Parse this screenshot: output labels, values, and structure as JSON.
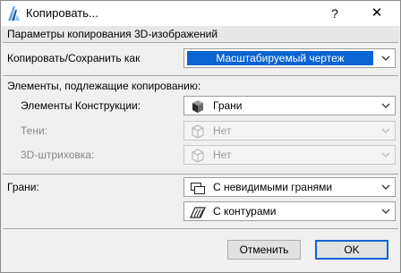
{
  "window": {
    "title": "Копировать...",
    "help_label": "?",
    "close_label": "✕"
  },
  "header": "Параметры копирования 3D-изображений",
  "copy_save": {
    "label": "Копировать/Сохранить как",
    "value": "Масштабируемый чертеж"
  },
  "elements_section": {
    "label": "Элементы, подлежащие копированию:",
    "rows": [
      {
        "label": "Элементы Конструкции:",
        "value": "Грани",
        "enabled": true,
        "icon": "solid-cube-icon"
      },
      {
        "label": "Тени:",
        "value": "Нет",
        "enabled": false,
        "icon": "wire-cube-icon"
      },
      {
        "label": "3D-штриховка:",
        "value": "Нет",
        "enabled": false,
        "icon": "wire-cube-icon"
      }
    ]
  },
  "faces": {
    "label": "Грани:",
    "options": [
      {
        "value": "С невидимыми гранями",
        "icon": "hidden-faces-icon"
      },
      {
        "value": "С контурами",
        "icon": "outline-icon"
      }
    ]
  },
  "buttons": {
    "cancel": "Отменить",
    "ok": "OK"
  }
}
